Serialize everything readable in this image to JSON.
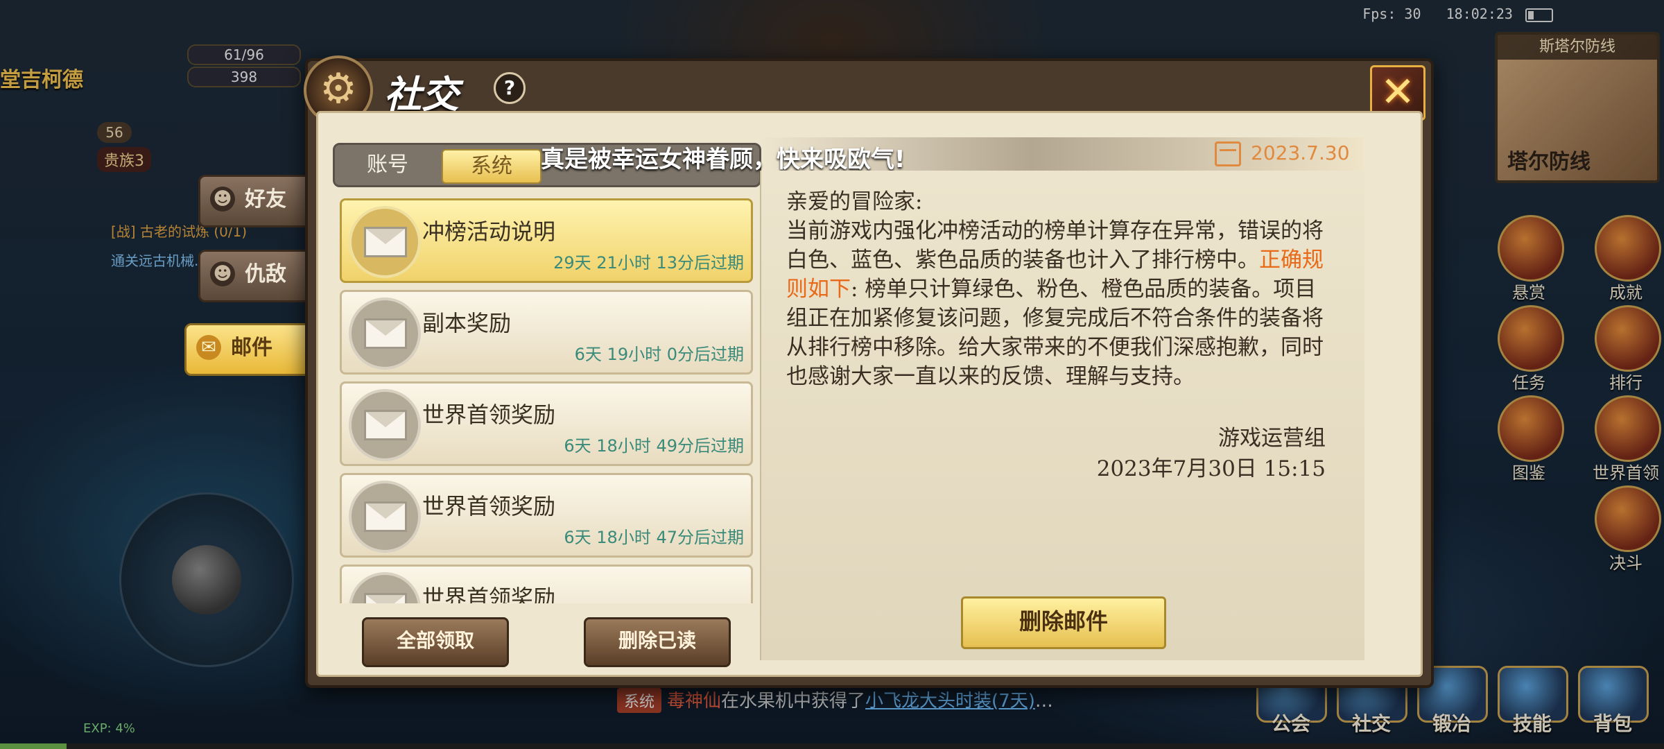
{
  "status_bar": {
    "fps": "Fps: 30",
    "time": "18:02:23"
  },
  "player": {
    "name": "堂吉柯德",
    "hp": "61/96",
    "gold": "398",
    "level": "56",
    "vip": "贵族3"
  },
  "quest": {
    "tab": "任务",
    "line1": "[战] 古老的试炼 (0/1)",
    "line2": "通关远古机械..."
  },
  "minimap": {
    "title": "斯塔尔防线",
    "sub": "塔尔防线"
  },
  "exp_label": "EXP: 4%",
  "exp_progress": 0.04,
  "right_icons": [
    "悬赏",
    "成就",
    "任务",
    "排行",
    "图鉴",
    "世界首领",
    "决斗"
  ],
  "bottom_nav": [
    "公会",
    "社交",
    "锻冶",
    "技能",
    "背包"
  ],
  "chat": {
    "tag": "系统",
    "who": "毒神仙",
    "text": "在水果机中获得了",
    "item": "小飞龙大头时装(7天)",
    "more": "…"
  },
  "modal": {
    "title": "社交",
    "help": "?",
    "side_tabs": [
      {
        "label": "好友",
        "icon": "friend-icon"
      },
      {
        "label": "仇敌",
        "icon": "enemy-icon"
      },
      {
        "label": "邮件",
        "icon": "mail-icon",
        "active": true
      }
    ],
    "segments": [
      "账号",
      "系统"
    ],
    "ticker": "真是被幸运女神眷顾，快来吸欧气!",
    "mails": [
      {
        "subject": "冲榜活动说明",
        "expire": "29天  21小时  13分后过期",
        "selected": true
      },
      {
        "subject": "副本奖励",
        "expire": "6天  19小时  0分后过期"
      },
      {
        "subject": "世界首领奖励",
        "expire": "6天  18小时  49分后过期"
      },
      {
        "subject": "世界首领奖励",
        "expire": "6天  18小时  47分后过期"
      },
      {
        "subject": "世界首领奖励",
        "expire": ""
      }
    ],
    "buttons": {
      "collect_all": "全部领取",
      "delete_read": "删除已读",
      "delete_mail": "删除邮件"
    },
    "detail": {
      "date": "2023.7.30",
      "greeting": "亲爱的冒险家:",
      "body1": "当前游戏内强化冲榜活动的榜单计算存在异常，错误的将白色、蓝色、紫色品质的装备也计入了排行榜中。",
      "highlight": "正确规则如下",
      "body2": ": 榜单只计算绿色、粉色、橙色品质的装备。项目组正在加紧修复该问题，修复完成后不符合条件的装备将从排行榜中移除。给大家带来的不便我们深感抱歉，同时也感谢大家一直以来的反馈、理解与支持。",
      "signature": "游戏运营组",
      "datetime": "2023年7月30日  15:15"
    }
  }
}
